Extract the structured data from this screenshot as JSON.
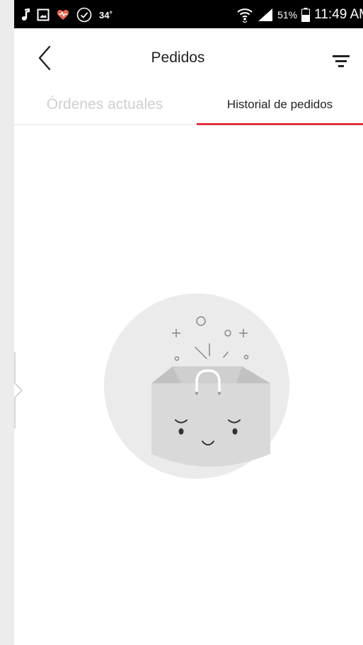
{
  "status_bar": {
    "temperature": "34˚",
    "battery": "51%",
    "time": "11:49 AM",
    "icons": [
      "music-note-icon",
      "gallery-icon",
      "health-heart-icon",
      "check-circle-icon",
      "wifi-icon",
      "signal-icon",
      "battery-icon"
    ]
  },
  "header": {
    "title": "Pedidos",
    "back_icon": "chevron-left-icon",
    "filter_icon": "filter-icon"
  },
  "tabs": [
    {
      "label": "Órdenes actuales",
      "active": false
    },
    {
      "label": "Historial de pedidos",
      "active": true
    }
  ],
  "colors": {
    "accent": "#e0323c",
    "inactive_tab": "#cfcfcf",
    "illustration_circle": "#ebebeb",
    "illustration_bag": "#d9d9d9"
  },
  "empty_state": {
    "icon": "empty-shopping-bag-icon"
  }
}
